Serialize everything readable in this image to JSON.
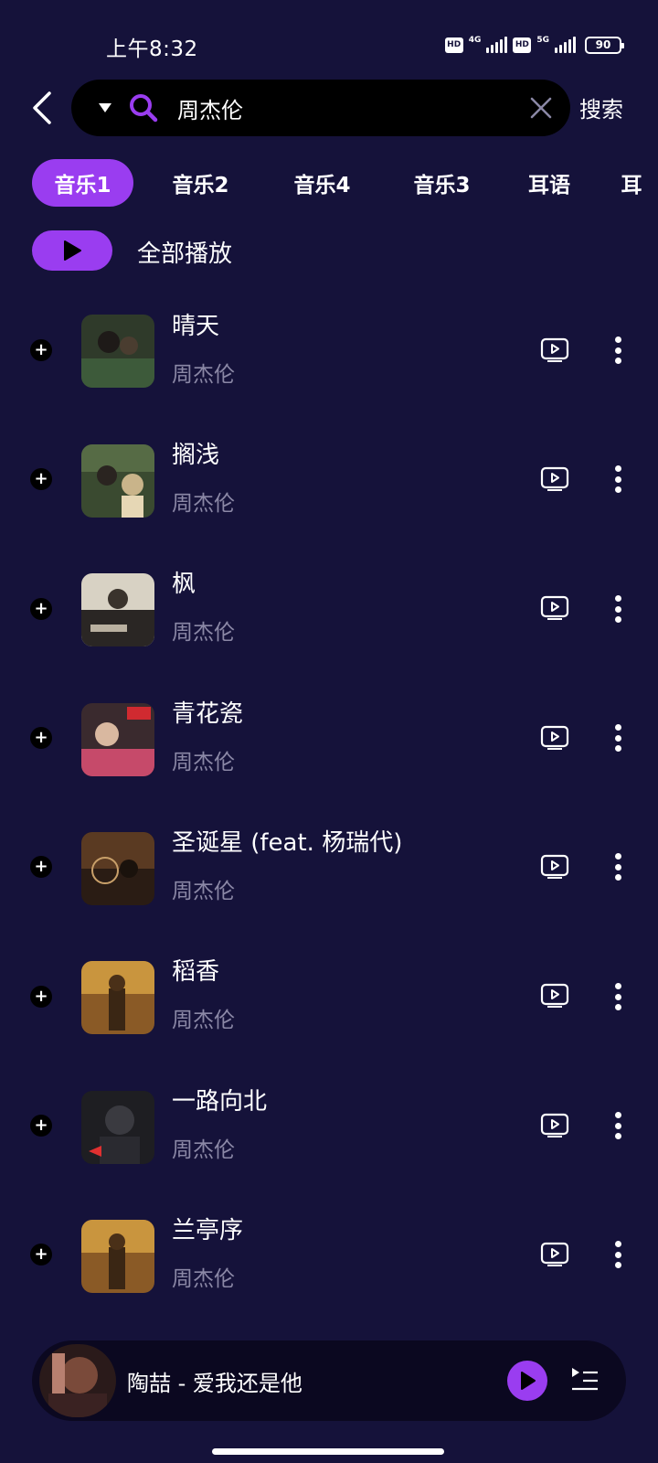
{
  "status_bar": {
    "time": "上午8:32",
    "hd_label": "HD",
    "net1": "4G",
    "net2": "5G",
    "battery": "90"
  },
  "search": {
    "query": "周杰伦",
    "button_label": "搜索"
  },
  "tabs": [
    "音乐1",
    "音乐2",
    "音乐4",
    "音乐3",
    "耳语",
    "耳"
  ],
  "active_tab": "音乐1",
  "play_all_label": "全部播放",
  "songs": [
    {
      "title": "晴天",
      "artist": "周杰伦"
    },
    {
      "title": "搁浅",
      "artist": "周杰伦"
    },
    {
      "title": "枫",
      "artist": "周杰伦"
    },
    {
      "title": "青花瓷",
      "artist": "周杰伦"
    },
    {
      "title": "圣诞星 (feat. 杨瑞代)",
      "artist": "周杰伦"
    },
    {
      "title": "稻香",
      "artist": "周杰伦"
    },
    {
      "title": "一路向北",
      "artist": "周杰伦"
    },
    {
      "title": "兰亭序",
      "artist": "周杰伦"
    }
  ],
  "now_playing": {
    "title": "陶喆 - 爱我还是他"
  },
  "colors": {
    "background": "#15123a",
    "accent": "#9a3df0",
    "secondary_text": "#8b88a6"
  }
}
